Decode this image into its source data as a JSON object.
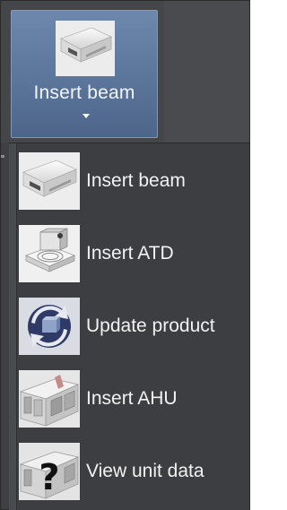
{
  "ribbon": {
    "button_label": "Insert beam",
    "button_icon": "chilled-beam-icon"
  },
  "menu": {
    "items": [
      {
        "label": "Insert beam",
        "icon": "chilled-beam-icon"
      },
      {
        "label": "Insert ATD",
        "icon": "air-terminal-device-icon"
      },
      {
        "label": "Update product",
        "icon": "update-product-icon"
      },
      {
        "label": "Insert AHU",
        "icon": "air-handling-unit-icon"
      },
      {
        "label": "View unit data",
        "icon": "view-unit-data-icon"
      }
    ]
  },
  "colors": {
    "ribbon_button": "#5a7399",
    "menu_background": "#3d3e41",
    "text": "#f2f2f2"
  }
}
